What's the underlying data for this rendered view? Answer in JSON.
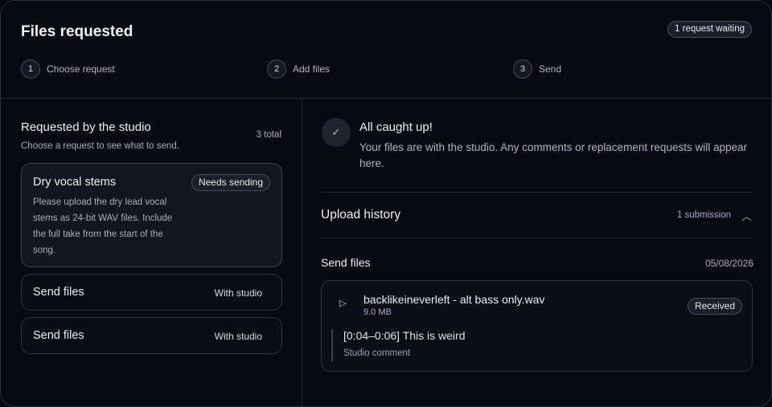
{
  "header": {
    "title": "Files requested",
    "waiting_badge": "1 request waiting",
    "steps": [
      {
        "num": "1",
        "label": "Choose request"
      },
      {
        "num": "2",
        "label": "Add files"
      },
      {
        "num": "3",
        "label": "Send"
      }
    ]
  },
  "requests": {
    "title": "Requested by the studio",
    "subtitle": "Choose a request to see what to send.",
    "total": "3 total",
    "items": [
      {
        "title": "Dry vocal stems",
        "badge": "Needs sending",
        "description": "Please upload the dry lead vocal stems as 24-bit WAV files. Include the full take from the start of the song."
      },
      {
        "title": "Send files",
        "status": "With studio"
      },
      {
        "title": "Send files",
        "status": "With studio"
      }
    ]
  },
  "detail": {
    "caught_title": "All caught up!",
    "caught_text": "Your files are with the studio. Any comments or replacement requests will appear here.",
    "check_icon": "✓",
    "history": {
      "title": "Upload history",
      "count": "1 submission",
      "toggle_icon": "︿"
    },
    "submission": {
      "title": "Send files",
      "date": "05/08/2026",
      "file": {
        "play_icon": "▷",
        "name": "backlikeineverleft - alt bass only.wav",
        "size": "9.0 MB",
        "status": "Received"
      },
      "comment": {
        "text": "[0:04–0:06] This is weird",
        "label": "Studio comment"
      }
    }
  }
}
